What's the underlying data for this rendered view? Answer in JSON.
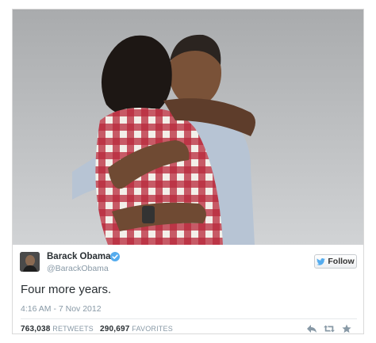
{
  "tweet": {
    "user_name": "Barack Obama",
    "user_handle": "@BarackObama",
    "follow_label": "Follow",
    "text": "Four more years.",
    "timestamp": "4:16 AM - 7 Nov 2012",
    "retweets_count": "763,038",
    "retweets_label": "RETWEETS",
    "favorites_count": "290,697",
    "favorites_label": "FAVORITES"
  },
  "icons": {
    "verified": "verified-badge-icon",
    "follow": "twitter-bird-icon",
    "reply": "reply-icon",
    "retweet": "retweet-icon",
    "favorite": "star-icon"
  },
  "colors": {
    "verified": "#55acee",
    "bird": "#55acee",
    "text": "#292f33",
    "muted": "#8899a6"
  }
}
